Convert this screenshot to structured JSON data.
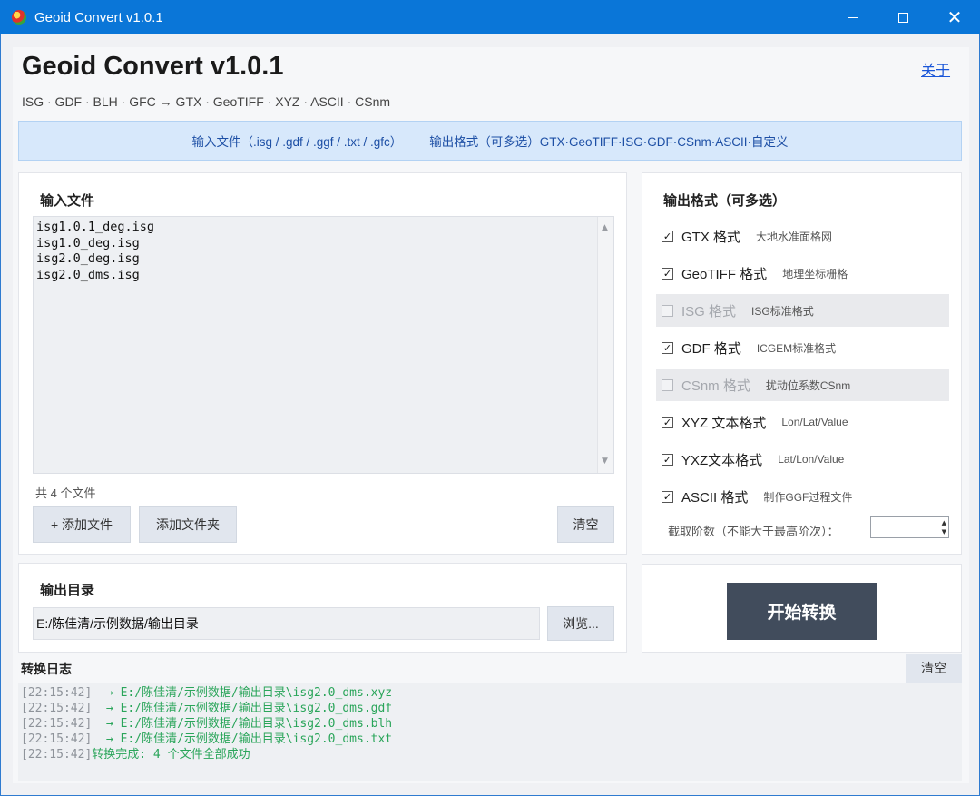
{
  "window": {
    "title": "Geoid Convert v1.0.1",
    "icons": {
      "app": "globe-icon",
      "minimize": "minimize-icon",
      "maximize": "maximize-icon",
      "close": "close-icon"
    },
    "titlebar_color": "#0a76d8"
  },
  "header": {
    "title": "Geoid Convert v1.0.1",
    "subtitle": "ISG · GDF · BLH · GFC  →  GTX · GeoTIFF · XYZ · ASCII · CSnm",
    "about_link": "关于"
  },
  "banner": {
    "input_info": "输入文件（.isg / .gdf / .ggf / .txt / .gfc）",
    "output_info": "输出格式（可多选）GTX·GeoTIFF·ISG·GDF·CSnm·ASCII·自定义"
  },
  "input_panel": {
    "title": "输入文件",
    "files": [
      "isg1.0.1_deg.isg",
      "isg1.0_deg.isg",
      "isg2.0_deg.isg",
      "isg2.0_dms.isg"
    ],
    "file_count": "共 4 个文件",
    "add_file_button": "+ 添加文件",
    "add_folder_button": "添加文件夹",
    "clear_button": "清空"
  },
  "format_panel": {
    "title": "输出格式（可多选）",
    "formats": [
      {
        "name": "GTX 格式",
        "desc": "大地水准面格网",
        "checked": true,
        "enabled": true
      },
      {
        "name": "GeoTIFF 格式",
        "desc": "地理坐标栅格",
        "checked": true,
        "enabled": true
      },
      {
        "name": "ISG 格式",
        "desc": "ISG标准格式",
        "checked": false,
        "enabled": false
      },
      {
        "name": "GDF 格式",
        "desc": "ICGEM标准格式",
        "checked": true,
        "enabled": true
      },
      {
        "name": "CSnm 格式",
        "desc": "扰动位系数CSnm",
        "checked": false,
        "enabled": false
      },
      {
        "name": "XYZ 文本格式",
        "desc": "Lon/Lat/Value",
        "checked": true,
        "enabled": true
      },
      {
        "name": "YXZ文本格式",
        "desc": "Lat/Lon/Value",
        "checked": true,
        "enabled": true
      },
      {
        "name": "ASCII 格式",
        "desc": "制作GGF过程文件",
        "checked": true,
        "enabled": true
      }
    ],
    "truncation_label": "截取阶数（不能大于最高阶次）：",
    "truncation_value": ""
  },
  "output_panel": {
    "title": "输出目录",
    "directory": "E:/陈佳清/示例数据/输出目录",
    "browse_button": "浏览..."
  },
  "start_button": "开始转换",
  "log": {
    "title": "转换日志",
    "clear_button": "清空",
    "lines": [
      {
        "time": "[22:15:42]",
        "msg": "  → E:/陈佳清/示例数据/输出目录\\isg2.0_dms.xyz"
      },
      {
        "time": "[22:15:42]",
        "msg": "  → E:/陈佳清/示例数据/输出目录\\isg2.0_dms.gdf"
      },
      {
        "time": "[22:15:42]",
        "msg": "  → E:/陈佳清/示例数据/输出目录\\isg2.0_dms.blh"
      },
      {
        "time": "[22:15:42]",
        "msg": "  → E:/陈佳清/示例数据/输出目录\\isg2.0_dms.txt"
      },
      {
        "time": "[22:15:42]",
        "msg": "转换完成: 4 个文件全部成功"
      }
    ],
    "message_color": "#2aa55a"
  }
}
